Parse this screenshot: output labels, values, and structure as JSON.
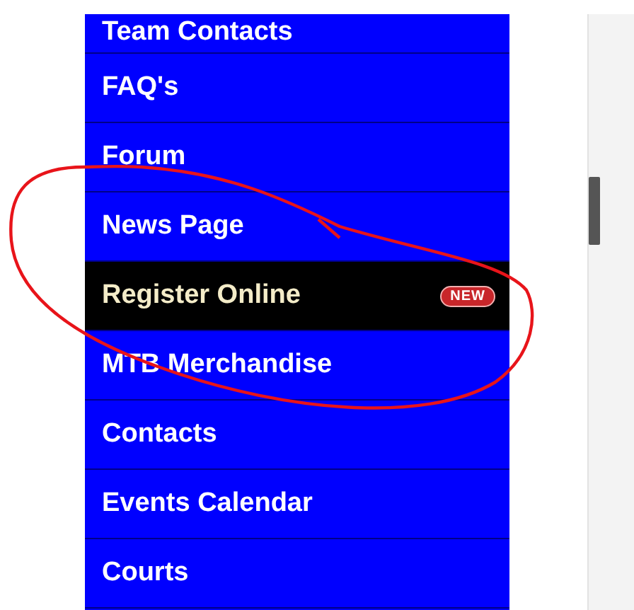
{
  "menu": [
    {
      "label": "Team Contacts",
      "selected": false
    },
    {
      "label": "FAQ's",
      "selected": false
    },
    {
      "label": "Forum",
      "selected": false
    },
    {
      "label": "News Page",
      "selected": false
    },
    {
      "label": "Register Online",
      "selected": true,
      "badge": "NEW"
    },
    {
      "label": "MTB Merchandise",
      "selected": false
    },
    {
      "label": "Contacts",
      "selected": false
    },
    {
      "label": "Events Calendar",
      "selected": false
    },
    {
      "label": "Courts",
      "selected": false
    }
  ]
}
